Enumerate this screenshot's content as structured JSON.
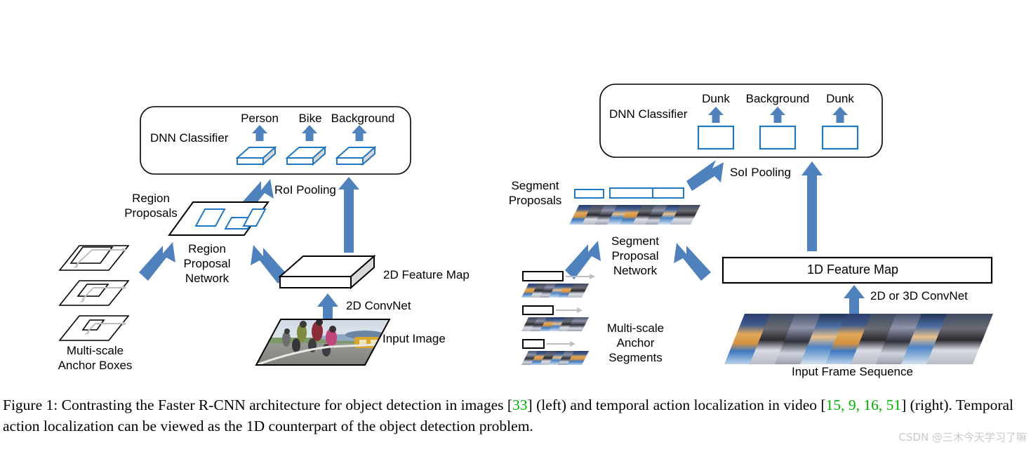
{
  "figure": {
    "left_panel": {
      "classifier_box_label": "DNN Classifier",
      "class_labels": [
        "Person",
        "Bike",
        "Background"
      ],
      "roi_pooling_label": "RoI Pooling",
      "region_proposals_label": "Region\nProposals",
      "rpn_label": "Region\nProposal\nNetwork",
      "anchor_boxes_label": "Multi-scale\nAnchor Boxes",
      "feature_map_label": "2D Feature Map",
      "convnet_label": "2D ConvNet",
      "input_label": "Input Image"
    },
    "right_panel": {
      "classifier_box_label": "DNN Classifier",
      "class_labels": [
        "Dunk",
        "Background",
        "Dunk"
      ],
      "soi_pooling_label": "SoI Pooling",
      "segment_proposals_label": "Segment\nProposals",
      "spn_label": "Segment\nProposal\nNetwork",
      "anchor_segments_label": "Multi-scale\nAnchor\nSegments",
      "feature_map_label": "1D Feature Map",
      "convnet_label": "2D or 3D ConvNet",
      "input_label": "Input Frame Sequence"
    },
    "colors": {
      "arrow_blue": "#4f81bd",
      "outline_blue": "#1f78c1",
      "gray_arrow": "#bfbfbf",
      "black": "#000000",
      "citation_green": "#00b300",
      "watermark_gray": "#c9c9c9"
    }
  },
  "caption": {
    "prefix": "Figure 1:",
    "part1": " Contrasting the Faster R-CNN architecture for object detection in images [",
    "cite1": "33",
    "part2": "] (left) and temporal action localization in video [",
    "cite2": "15, 9, 16, 51",
    "part3": "] (right). Temporal action localization can be viewed as the 1D counterpart of the object detection problem."
  },
  "watermark": {
    "text": "CSDN @三木今天学习了嘛"
  }
}
